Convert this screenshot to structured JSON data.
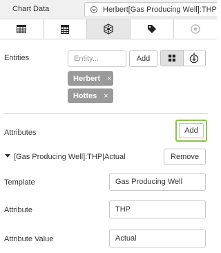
{
  "header": {
    "title": "Chart Data",
    "chart_select_value": "Herbert[Gas Producing Well]:THP"
  },
  "tabs": [
    {
      "icon": "table-icon"
    },
    {
      "icon": "calculator-icon"
    },
    {
      "icon": "network-icon",
      "active": true
    },
    {
      "icon": "tag-icon"
    },
    {
      "icon": "circle-icon"
    }
  ],
  "entities": {
    "label": "Entities",
    "input_placeholder": "Entity...",
    "add_label": "Add",
    "tags": [
      {
        "name": "Herbert",
        "remove": "×"
      },
      {
        "name": "Hottes",
        "remove": "×"
      }
    ]
  },
  "attributes": {
    "label": "Attributes",
    "add_label": "Add",
    "item_title": "[Gas Producing Well]:THP|Actual",
    "remove_label": "Remove",
    "fields": {
      "template_label": "Template",
      "template_value": "Gas Producing Well",
      "attribute_label": "Attribute",
      "attribute_value": "THP",
      "attribute_value_label": "Attribute Value",
      "attribute_value_value": "Actual"
    }
  },
  "colors": {
    "highlight": "#8bc34a",
    "tag_bg": "#9a9a9a"
  }
}
